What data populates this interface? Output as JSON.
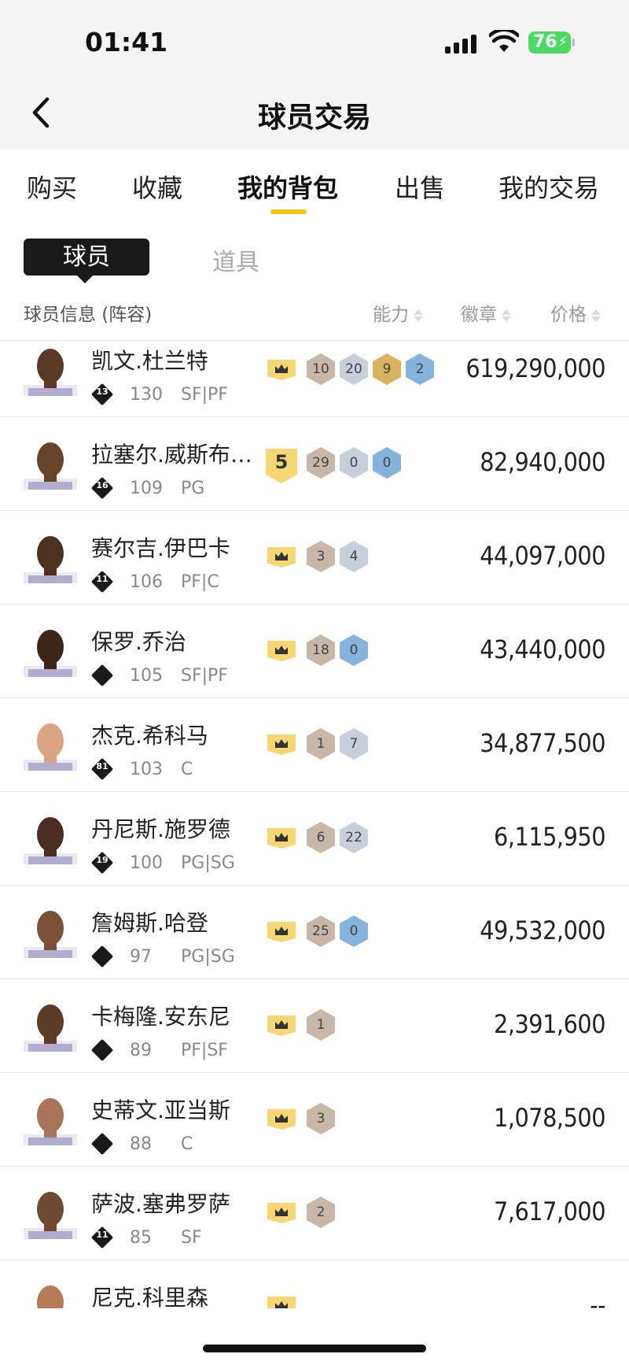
{
  "status": {
    "time": "01:41",
    "battery": "76"
  },
  "header": {
    "title": "球员交易"
  },
  "tabs": [
    {
      "label": "购买"
    },
    {
      "label": "收藏"
    },
    {
      "label": "我的背包"
    },
    {
      "label": "出售"
    },
    {
      "label": "我的交易"
    }
  ],
  "subtabs": {
    "active": "球员",
    "other": "道具"
  },
  "columns": {
    "info": "球员信息 (阵容)",
    "ability": "能力",
    "badge": "徽章",
    "price": "价格"
  },
  "players": [
    {
      "name": "凯文.杜兰特",
      "tier": "13",
      "rating": "130",
      "pos": "SF|PF",
      "level": "",
      "badges": [
        {
          "v": "10",
          "c": "bronze"
        },
        {
          "v": "20",
          "c": "silver"
        },
        {
          "v": "9",
          "c": "gold"
        },
        {
          "v": "2",
          "c": "blue"
        }
      ],
      "price": "619,290,000"
    },
    {
      "name": "拉塞尔.威斯布…",
      "tier": "16",
      "rating": "109",
      "pos": "PG",
      "level": "5",
      "badges": [
        {
          "v": "29",
          "c": "bronze"
        },
        {
          "v": "0",
          "c": "silver"
        },
        {
          "v": "0",
          "c": "blue"
        }
      ],
      "price": "82,940,000"
    },
    {
      "name": "赛尔吉.伊巴卡",
      "tier": "11",
      "rating": "106",
      "pos": "PF|C",
      "level": "",
      "badges": [
        {
          "v": "3",
          "c": "bronze"
        },
        {
          "v": "4",
          "c": "silver"
        }
      ],
      "price": "44,097,000"
    },
    {
      "name": "保罗.乔治",
      "tier": "",
      "rating": "105",
      "pos": "SF|PF",
      "level": "",
      "badges": [
        {
          "v": "18",
          "c": "bronze"
        },
        {
          "v": "0",
          "c": "blue"
        }
      ],
      "price": "43,440,000"
    },
    {
      "name": "杰克.希科马",
      "tier": "81",
      "rating": "103",
      "pos": "C",
      "level": "",
      "badges": [
        {
          "v": "1",
          "c": "bronze"
        },
        {
          "v": "7",
          "c": "silver"
        }
      ],
      "price": "34,877,500"
    },
    {
      "name": "丹尼斯.施罗德",
      "tier": "19",
      "rating": "100",
      "pos": "PG|SG",
      "level": "",
      "badges": [
        {
          "v": "6",
          "c": "bronze"
        },
        {
          "v": "22",
          "c": "silver"
        }
      ],
      "price": "6,115,950"
    },
    {
      "name": "詹姆斯.哈登",
      "tier": "",
      "rating": "97",
      "pos": "PG|SG",
      "level": "",
      "badges": [
        {
          "v": "25",
          "c": "bronze"
        },
        {
          "v": "0",
          "c": "blue"
        }
      ],
      "price": "49,532,000"
    },
    {
      "name": "卡梅隆.安东尼",
      "tier": "",
      "rating": "89",
      "pos": "PF|SF",
      "level": "",
      "badges": [
        {
          "v": "1",
          "c": "bronze"
        }
      ],
      "price": "2,391,600"
    },
    {
      "name": "史蒂文.亚当斯",
      "tier": "",
      "rating": "88",
      "pos": "C",
      "level": "",
      "badges": [
        {
          "v": "3",
          "c": "bronze"
        }
      ],
      "price": "1,078,500"
    },
    {
      "name": "萨波.塞弗罗萨",
      "tier": "11",
      "rating": "85",
      "pos": "SF",
      "level": "",
      "badges": [
        {
          "v": "2",
          "c": "bronze"
        }
      ],
      "price": "7,617,000"
    },
    {
      "name": "尼克.科里森",
      "tier": "",
      "rating": "",
      "pos": "",
      "level": "",
      "badges": [],
      "price": "--"
    }
  ]
}
